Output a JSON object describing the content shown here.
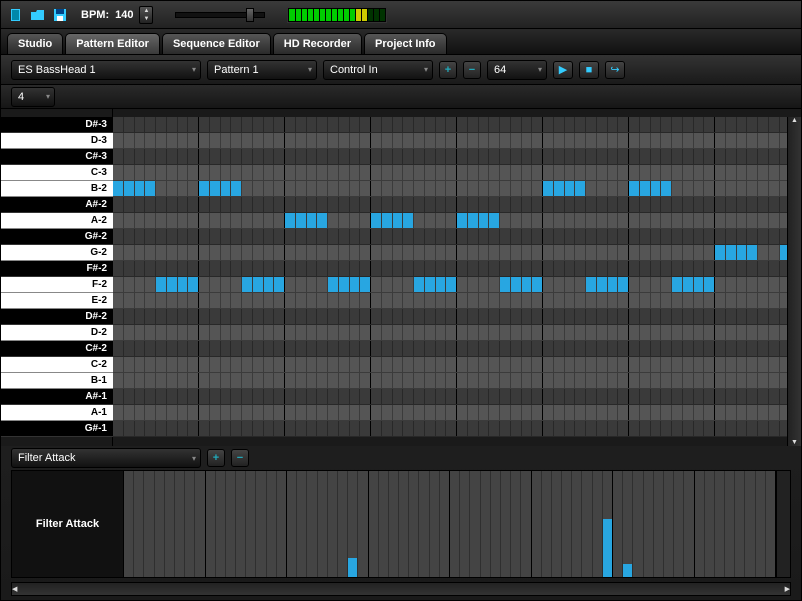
{
  "toolbar": {
    "bpm_label": "BPM:",
    "bpm_value": "140"
  },
  "tabs": [
    {
      "label": "Studio"
    },
    {
      "label": "Pattern Editor"
    },
    {
      "label": "Sequence Editor"
    },
    {
      "label": "HD Recorder"
    },
    {
      "label": "Project Info"
    }
  ],
  "controls": {
    "instrument": "ES BassHead 1",
    "pattern": "Pattern 1",
    "midi": "Control In",
    "steps": "64"
  },
  "beats_per_bar": "4",
  "keys": [
    {
      "name": "D#-3",
      "black": true
    },
    {
      "name": "D-3",
      "black": false
    },
    {
      "name": "C#-3",
      "black": true
    },
    {
      "name": "C-3",
      "black": false
    },
    {
      "name": "B-2",
      "black": false
    },
    {
      "name": "A#-2",
      "black": true
    },
    {
      "name": "A-2",
      "black": false
    },
    {
      "name": "G#-2",
      "black": true
    },
    {
      "name": "G-2",
      "black": false
    },
    {
      "name": "F#-2",
      "black": true
    },
    {
      "name": "F-2",
      "black": false
    },
    {
      "name": "E-2",
      "black": false
    },
    {
      "name": "D#-2",
      "black": true
    },
    {
      "name": "D-2",
      "black": false
    },
    {
      "name": "C#-2",
      "black": true
    },
    {
      "name": "C-2",
      "black": false
    },
    {
      "name": "B-1",
      "black": false
    },
    {
      "name": "A#-1",
      "black": true
    },
    {
      "name": "A-1",
      "black": false
    },
    {
      "name": "G#-1",
      "black": true
    }
  ],
  "steps_total": 64,
  "notes": [
    {
      "key": "B-2",
      "start": 0,
      "len": 4
    },
    {
      "key": "B-2",
      "start": 8,
      "len": 4
    },
    {
      "key": "B-2",
      "start": 40,
      "len": 4
    },
    {
      "key": "B-2",
      "start": 48,
      "len": 4
    },
    {
      "key": "A-2",
      "start": 16,
      "len": 4
    },
    {
      "key": "A-2",
      "start": 24,
      "len": 4
    },
    {
      "key": "A-2",
      "start": 32,
      "len": 4
    },
    {
      "key": "G-2",
      "start": 56,
      "len": 4
    },
    {
      "key": "G-2",
      "start": 62,
      "len": 2
    },
    {
      "key": "F-2",
      "start": 4,
      "len": 4
    },
    {
      "key": "F-2",
      "start": 12,
      "len": 4
    },
    {
      "key": "F-2",
      "start": 20,
      "len": 4
    },
    {
      "key": "F-2",
      "start": 28,
      "len": 4
    },
    {
      "key": "F-2",
      "start": 36,
      "len": 4
    },
    {
      "key": "F-2",
      "start": 44,
      "len": 4
    },
    {
      "key": "F-2",
      "start": 52,
      "len": 4
    }
  ],
  "automation": {
    "param": "Filter Attack",
    "label": "Filter Attack",
    "values": {
      "22": 18,
      "47": 55,
      "49": 12
    }
  }
}
